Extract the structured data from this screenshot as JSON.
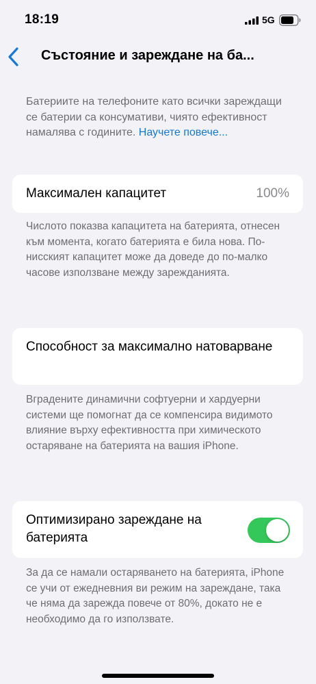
{
  "status_bar": {
    "time": "18:19",
    "network": "5G",
    "signal_icon": "cellular-signal-icon",
    "battery_icon": "battery-icon"
  },
  "nav": {
    "back_icon": "chevron-left-icon",
    "title": "Състояние и зареждане на ба..."
  },
  "intro": {
    "text": "Батериите на телефоните като всички зареждащи се батерии са консумативи, чиято ефективност намалява с годините. ",
    "link": "Научете повече..."
  },
  "max_capacity": {
    "label": "Максимален капацитет",
    "value": "100%",
    "footnote": "Числото показва капацитета на батерията, отнесен към момента, когато батерията е била нова. По-нисският капацитет може да доведе до по-малко часове използване между зарежданията."
  },
  "peak_performance": {
    "label": "Способност за максимално натоварване",
    "footnote": "Вградените динамични софтуерни и хардуерни системи ще помогнат да се компенсира видимото влияние върху ефективността при химическото остаряване на батерията на вашия iPhone."
  },
  "optimized_charging": {
    "label": "Оптимизирано зареждане на батерията",
    "enabled": true,
    "footnote": "За да се намали остаряването на батерията, iPhone се учи от ежедневния ви режим на зареждане, така че няма да зарежда повече от 80%, докато не е необходимо да го използвате."
  },
  "colors": {
    "background": "#f2f2f7",
    "accent": "#1479d9",
    "toggle_on": "#34c759",
    "secondary_text": "#6d6d72"
  }
}
